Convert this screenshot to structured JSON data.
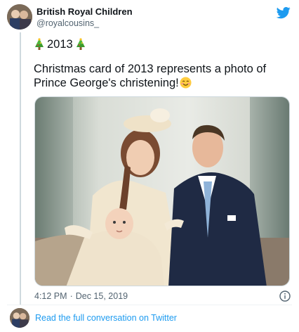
{
  "author": {
    "display_name": "British Royal Children",
    "handle": "@royalcousins_",
    "avatar_icon": "avatar-photo-icon"
  },
  "tweet": {
    "year_label": "2013",
    "text": "Christmas card of 2013 represents a photo of Prince George's christening!",
    "emojis": [
      "christmas-tree-icon",
      "christmas-tree-icon",
      "smiling-face-icon"
    ],
    "time": "4:12 PM",
    "separator": "·",
    "date": "Dec 15, 2019"
  },
  "footer": {
    "link_text": "Read the full conversation on Twitter"
  },
  "colors": {
    "link": "#1d9bf0",
    "muted": "#536471",
    "text": "#0f1419"
  }
}
